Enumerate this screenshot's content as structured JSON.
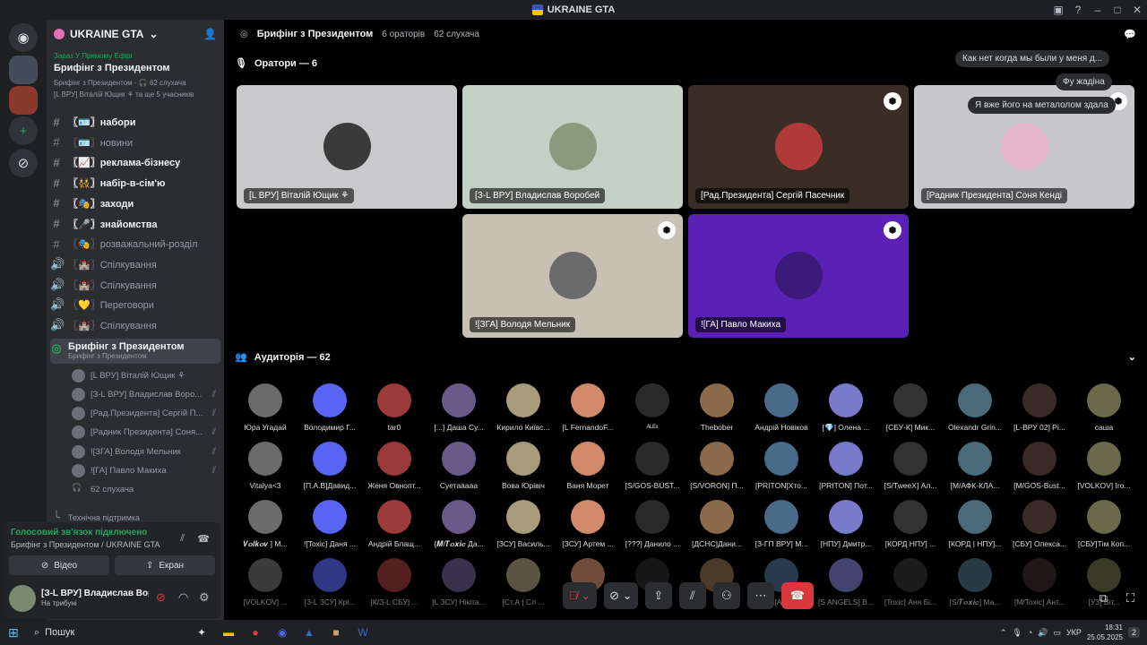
{
  "window": {
    "title": "UKRAINE GTA"
  },
  "server": {
    "name": "UKRAINE GTA"
  },
  "live": {
    "label": "Зараз У Прямому Ефірі",
    "event": "Брифінг з Президентом",
    "sub": "Брифінг з Президентом · 🎧 62 слухача",
    "sub2": "[L ВРУ] Віталій Ющик ⚘ та ще 5 учасників"
  },
  "channels": [
    {
      "label": "〖🪪〗набори",
      "icon": "#",
      "bold": true
    },
    {
      "label": "〖🪪〗новини",
      "icon": "#",
      "bold": false
    },
    {
      "label": "〖📈〗реклама-бізнесу",
      "icon": "#",
      "bold": true
    },
    {
      "label": "〖👯〗набір-в-сім'ю",
      "icon": "#",
      "bold": true
    },
    {
      "label": "〖🎭〗заходи",
      "icon": "#",
      "bold": true
    },
    {
      "label": "〖🎤〗знайомства",
      "icon": "#",
      "bold": true
    },
    {
      "label": "〖🎭〗розважальний-розділ",
      "icon": "#",
      "bold": false
    },
    {
      "label": "〖🏰〗Спілкування",
      "icon": "🔊",
      "bold": false
    },
    {
      "label": "〖🏰〗Спілкування",
      "icon": "🔊",
      "bold": false
    },
    {
      "label": "〖💛〗Переговори",
      "icon": "🔊",
      "bold": false
    },
    {
      "label": "〖🏰〗Спілкування",
      "icon": "🔊",
      "bold": false
    }
  ],
  "active_channel": {
    "label": "Брифінг з Президентом",
    "sub": "Брифінг з Президентом"
  },
  "voice_users": [
    "[L ВРУ] Віталій Ющик ⚘",
    "[З-L ВРУ] Владислав Воро...",
    "[Рад.Президента] Сергій П...",
    "[Радник Президента] Соня...",
    "![ЗГА] Володя Мельник",
    "![ГА] Павло Макиха",
    "62 слухача"
  ],
  "hidden_category": "Технічна підтримка",
  "voice_status": {
    "title": "Голосовий зв'язок підключено",
    "detail": "Брифінг з Президентом / UKRAINE GTA",
    "video": "Відео",
    "screen": "Екран"
  },
  "user": {
    "name": "[З-L ВРУ] Владислав Воро...",
    "status": "На трибуні"
  },
  "header": {
    "title": "Брифінг з Президентом",
    "speakers": "6 ораторів",
    "listeners": "62 слухача"
  },
  "speakers_title": "Оратори — 6",
  "speakers": [
    {
      "name": "[L ВРУ] Віталій Ющик ⚘",
      "bg": "#c9c9cb",
      "av": "#3a3a3a"
    },
    {
      "name": "[З-L ВРУ] Владислав Воробей",
      "bg": "#c2d0c6",
      "av": "#8a9a7a"
    },
    {
      "name": "[Рад.Президента] Сергій Пасечник",
      "bg": "#3a2d25",
      "av": "#b03a3a"
    },
    {
      "name": "[Радник Президента] Соня Кенді",
      "bg": "#c8c8cc",
      "av": "#e6b7c8"
    },
    {
      "name": "![ЗГА] Володя Мельник",
      "bg": "#c9c0b4",
      "av": "#6b6b6b"
    },
    {
      "name": "![ГА] Павло Макиха",
      "bg": "#5b21b6",
      "av": "#3b1a7a"
    }
  ],
  "chat_bubbles": [
    "Как нет когда мы были у меня д...",
    "Фу жадіна",
    "Я вже його на металолом здала"
  ],
  "audience_title": "Аудиторія — 62",
  "audience": [
    "Юра Угадай",
    "Володимир Г...",
    "tar0",
    "[...] Даша Су...",
    "Кирило Київс...",
    "[L FernandoF...",
    "ᴬᴸᴱˣ",
    "Thebober",
    "Андрій Новіков",
    "[💎] Олена ...",
    "[СБУ-К] Мик...",
    "Olexandr Grin...",
    "[L-ВРУ 02] Pi...",
    "саша",
    "Vitalya<3",
    "[П.А.В]Давид...",
    "Женя Овнопт...",
    "Суетааааа",
    "Вова Юрівіч",
    "Ваня Морет",
    "[S/GOS-BUST...",
    "[S/VORON] П...",
    "[PRITON]Хто...",
    "[PRITON] Пот...",
    "[S/TweeX] Ал...",
    "[М/АФК-КЛА...",
    "[M/GOS-Bust...",
    "[VOLKOV] Iro...",
    "𝑽𝒐𝒍𝒌𝒐𝒗 ] М...",
    "![Toxic] Даня ...",
    "Андрій Блащ...",
    "{𝑴/𝑻𝒐𝒙𝒊𝒄 Да...",
    "[ЗСУ] Василь...",
    "[ЗСУ] Артем ...",
    "[???] Данило ...",
    "[ДСНС]Дани...",
    "[З-ГП ВРУ] М...",
    "[НПУ] Дмитр...",
    "[КОРД НПУ] ...",
    "[КОРД | НПУ]...",
    "[СБУ] Олекса...",
    "[СБУ]Тім Коп...",
    "[VOLKOV] ...",
    "[З-L ЗСУ] Крі...",
    "[К/З-L СБУ] ...",
    "[L ЗСУ] Нікіта...",
    "[Ст.А | Сл ...",
    "",
    "",
    "",
    "[A...",
    "[S ANGELS] В...",
    "[Toxic] Аня Бі...",
    "[S/𝑻𝒐𝒙𝒊𝒄] Ма...",
    "[M/Toxic] Ант...",
    "[УЗ] Віт..."
  ],
  "taskbar": {
    "search": "Пошук",
    "lang": "УКР",
    "time": "18:31",
    "date": "25.05.2025",
    "badge": "2"
  }
}
